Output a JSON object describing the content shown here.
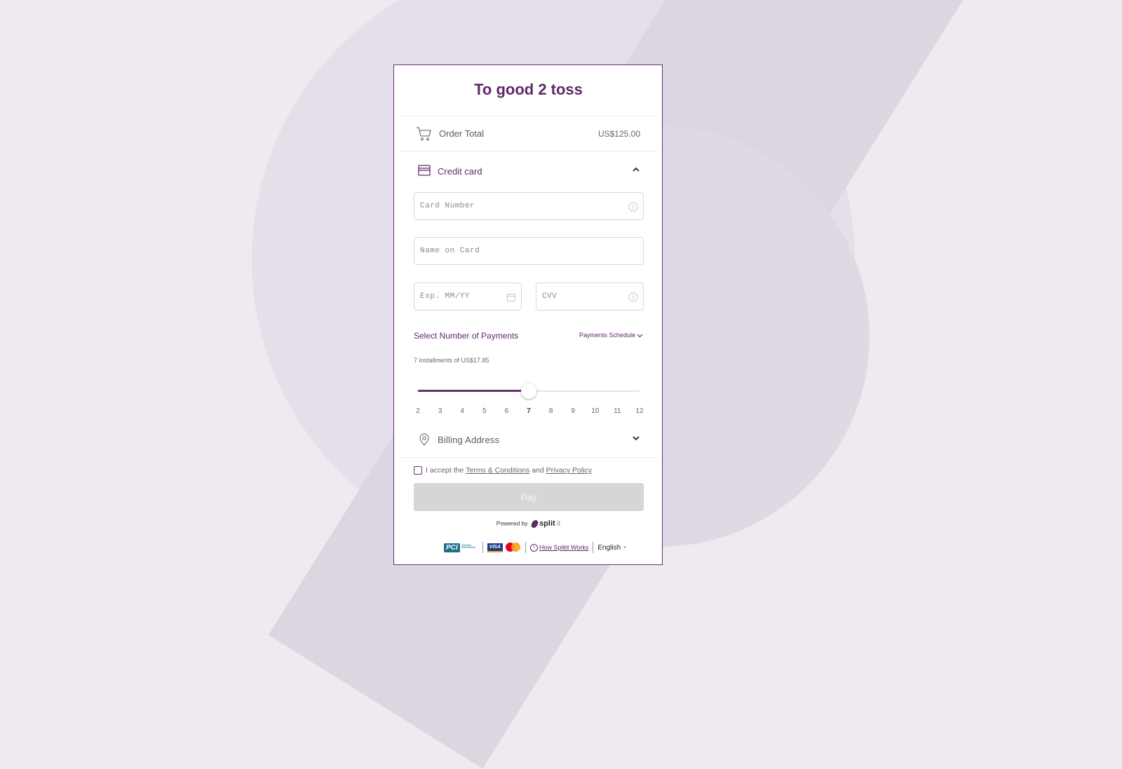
{
  "merchant": {
    "title": "To good 2 toss"
  },
  "order": {
    "label": "Order Total",
    "amount": "US$125.00"
  },
  "payment_method": {
    "label": "Credit card",
    "icon": "credit-card-icon",
    "expanded": true
  },
  "fields": {
    "card_number": {
      "placeholder": "Card Number",
      "value": ""
    },
    "name_on_card": {
      "placeholder": "Name on Card",
      "value": ""
    },
    "expiry": {
      "placeholder": "Exp. MM/YY",
      "value": ""
    },
    "cvv": {
      "placeholder": "CVV",
      "value": ""
    }
  },
  "installments": {
    "title": "Select Number of Payments",
    "schedule_label": "Payments Schedule",
    "summary": "7 installments of US$17.85",
    "options": [
      "2",
      "3",
      "4",
      "5",
      "6",
      "7",
      "8",
      "9",
      "10",
      "11",
      "12"
    ],
    "selected": "7",
    "selected_fraction": 0.5
  },
  "billing": {
    "label": "Billing Address",
    "expanded": false
  },
  "terms": {
    "prefix": "I accept the",
    "terms_link": "Terms & Conditions",
    "and": "and",
    "privacy_link": "Privacy Policy",
    "checked": false
  },
  "pay_button": {
    "label": "Pay",
    "enabled": false
  },
  "powered": {
    "prefix": "Powered by",
    "brand": "split",
    "brand_suffix": "it"
  },
  "footer": {
    "pci_badge": "PCI",
    "visa": "VISA",
    "how_link": "How Splitit Works",
    "language": "English",
    "language_arrow": "▾"
  },
  "colors": {
    "brand": "#5e2a67",
    "button_disabled": "#d6d6d6",
    "background": "#eeeaf0"
  }
}
